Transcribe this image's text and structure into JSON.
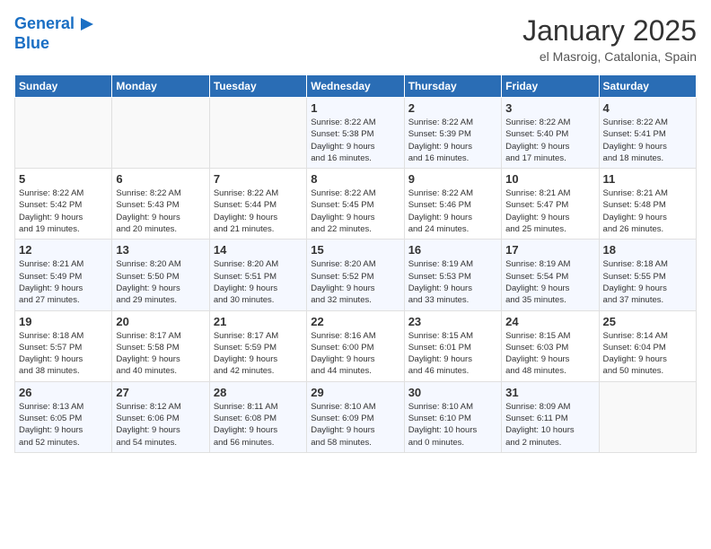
{
  "header": {
    "logo_line1": "General",
    "logo_line2": "Blue",
    "month": "January 2025",
    "location": "el Masroig, Catalonia, Spain"
  },
  "days_of_week": [
    "Sunday",
    "Monday",
    "Tuesday",
    "Wednesday",
    "Thursday",
    "Friday",
    "Saturday"
  ],
  "weeks": [
    [
      {
        "day": "",
        "info": ""
      },
      {
        "day": "",
        "info": ""
      },
      {
        "day": "",
        "info": ""
      },
      {
        "day": "1",
        "info": "Sunrise: 8:22 AM\nSunset: 5:38 PM\nDaylight: 9 hours\nand 16 minutes."
      },
      {
        "day": "2",
        "info": "Sunrise: 8:22 AM\nSunset: 5:39 PM\nDaylight: 9 hours\nand 16 minutes."
      },
      {
        "day": "3",
        "info": "Sunrise: 8:22 AM\nSunset: 5:40 PM\nDaylight: 9 hours\nand 17 minutes."
      },
      {
        "day": "4",
        "info": "Sunrise: 8:22 AM\nSunset: 5:41 PM\nDaylight: 9 hours\nand 18 minutes."
      }
    ],
    [
      {
        "day": "5",
        "info": "Sunrise: 8:22 AM\nSunset: 5:42 PM\nDaylight: 9 hours\nand 19 minutes."
      },
      {
        "day": "6",
        "info": "Sunrise: 8:22 AM\nSunset: 5:43 PM\nDaylight: 9 hours\nand 20 minutes."
      },
      {
        "day": "7",
        "info": "Sunrise: 8:22 AM\nSunset: 5:44 PM\nDaylight: 9 hours\nand 21 minutes."
      },
      {
        "day": "8",
        "info": "Sunrise: 8:22 AM\nSunset: 5:45 PM\nDaylight: 9 hours\nand 22 minutes."
      },
      {
        "day": "9",
        "info": "Sunrise: 8:22 AM\nSunset: 5:46 PM\nDaylight: 9 hours\nand 24 minutes."
      },
      {
        "day": "10",
        "info": "Sunrise: 8:21 AM\nSunset: 5:47 PM\nDaylight: 9 hours\nand 25 minutes."
      },
      {
        "day": "11",
        "info": "Sunrise: 8:21 AM\nSunset: 5:48 PM\nDaylight: 9 hours\nand 26 minutes."
      }
    ],
    [
      {
        "day": "12",
        "info": "Sunrise: 8:21 AM\nSunset: 5:49 PM\nDaylight: 9 hours\nand 27 minutes."
      },
      {
        "day": "13",
        "info": "Sunrise: 8:20 AM\nSunset: 5:50 PM\nDaylight: 9 hours\nand 29 minutes."
      },
      {
        "day": "14",
        "info": "Sunrise: 8:20 AM\nSunset: 5:51 PM\nDaylight: 9 hours\nand 30 minutes."
      },
      {
        "day": "15",
        "info": "Sunrise: 8:20 AM\nSunset: 5:52 PM\nDaylight: 9 hours\nand 32 minutes."
      },
      {
        "day": "16",
        "info": "Sunrise: 8:19 AM\nSunset: 5:53 PM\nDaylight: 9 hours\nand 33 minutes."
      },
      {
        "day": "17",
        "info": "Sunrise: 8:19 AM\nSunset: 5:54 PM\nDaylight: 9 hours\nand 35 minutes."
      },
      {
        "day": "18",
        "info": "Sunrise: 8:18 AM\nSunset: 5:55 PM\nDaylight: 9 hours\nand 37 minutes."
      }
    ],
    [
      {
        "day": "19",
        "info": "Sunrise: 8:18 AM\nSunset: 5:57 PM\nDaylight: 9 hours\nand 38 minutes."
      },
      {
        "day": "20",
        "info": "Sunrise: 8:17 AM\nSunset: 5:58 PM\nDaylight: 9 hours\nand 40 minutes."
      },
      {
        "day": "21",
        "info": "Sunrise: 8:17 AM\nSunset: 5:59 PM\nDaylight: 9 hours\nand 42 minutes."
      },
      {
        "day": "22",
        "info": "Sunrise: 8:16 AM\nSunset: 6:00 PM\nDaylight: 9 hours\nand 44 minutes."
      },
      {
        "day": "23",
        "info": "Sunrise: 8:15 AM\nSunset: 6:01 PM\nDaylight: 9 hours\nand 46 minutes."
      },
      {
        "day": "24",
        "info": "Sunrise: 8:15 AM\nSunset: 6:03 PM\nDaylight: 9 hours\nand 48 minutes."
      },
      {
        "day": "25",
        "info": "Sunrise: 8:14 AM\nSunset: 6:04 PM\nDaylight: 9 hours\nand 50 minutes."
      }
    ],
    [
      {
        "day": "26",
        "info": "Sunrise: 8:13 AM\nSunset: 6:05 PM\nDaylight: 9 hours\nand 52 minutes."
      },
      {
        "day": "27",
        "info": "Sunrise: 8:12 AM\nSunset: 6:06 PM\nDaylight: 9 hours\nand 54 minutes."
      },
      {
        "day": "28",
        "info": "Sunrise: 8:11 AM\nSunset: 6:08 PM\nDaylight: 9 hours\nand 56 minutes."
      },
      {
        "day": "29",
        "info": "Sunrise: 8:10 AM\nSunset: 6:09 PM\nDaylight: 9 hours\nand 58 minutes."
      },
      {
        "day": "30",
        "info": "Sunrise: 8:10 AM\nSunset: 6:10 PM\nDaylight: 10 hours\nand 0 minutes."
      },
      {
        "day": "31",
        "info": "Sunrise: 8:09 AM\nSunset: 6:11 PM\nDaylight: 10 hours\nand 2 minutes."
      },
      {
        "day": "",
        "info": ""
      }
    ]
  ]
}
